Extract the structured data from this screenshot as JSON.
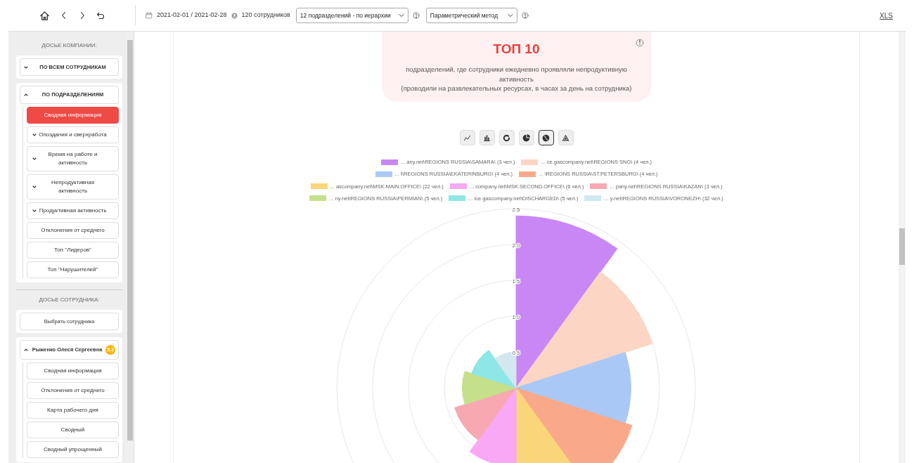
{
  "toolbar": {
    "date_range": "2021-02-01 / 2021-02-28",
    "employees": "120 сотрудников",
    "unit_select": "12 подразделений - по иерархии",
    "method_select": "Параметрический метод",
    "export_link": "XLS"
  },
  "sidebar": {
    "sections": [
      {
        "title": "ДОСЬЕ КОМПАНИИ:",
        "groups": [
          {
            "label": "ПО ВСЕМ СОТРУДНИКАМ",
            "kind": "accordion",
            "expanded": false
          },
          {
            "label": "ПО ПОДРАЗДЕЛЕНИЯМ",
            "kind": "accordion",
            "expanded": true,
            "items": [
              {
                "label": "Сводная информация",
                "kind": "link",
                "selected": true
              },
              {
                "label": "Опоздания и сверхработа",
                "kind": "submenu",
                "selected": false,
                "expanded": false
              },
              {
                "label": "Время на работе и активность",
                "kind": "submenu",
                "selected": false,
                "expanded": false
              },
              {
                "label": "Непродуктивная активность",
                "kind": "submenu",
                "selected": false,
                "expanded": false
              },
              {
                "label": "Продуктивная активность",
                "kind": "submenu",
                "selected": false,
                "expanded": false
              },
              {
                "label": "Отклонения от среднего",
                "kind": "link",
                "selected": false
              },
              {
                "label": "Топ \"Лидеров\"",
                "kind": "link",
                "selected": false
              },
              {
                "label": "Топ \"Нарушителей\"",
                "kind": "link",
                "selected": false
              }
            ]
          }
        ]
      },
      {
        "title": "ДОСЬЕ СОТРУДНИКА:",
        "groups": [
          {
            "label": "Выбрать сотрудника",
            "kind": "button"
          },
          {
            "label": "Рыженко Олеся Сергеевна",
            "kind": "accordion",
            "expanded": true,
            "badge": "5.3",
            "items": [
              {
                "label": "Сводная информация",
                "kind": "link",
                "selected": false
              },
              {
                "label": "Отклонения от среднего",
                "kind": "link",
                "selected": false
              },
              {
                "label": "Карта рабочего дня",
                "kind": "link",
                "selected": false
              },
              {
                "label": "Сводный",
                "kind": "link",
                "selected": false
              },
              {
                "label": "Сводный упрощенный",
                "kind": "link",
                "selected": false
              }
            ]
          }
        ]
      }
    ]
  },
  "report": {
    "title": "ТОП 10",
    "subtitle": "подразделений, где сотрудники ежедневно проявляли непродуктивную активность",
    "note": "(проводили на развлекательных ресурсах, в часах за день на сотрудника)",
    "chart_types": [
      {
        "kind": "line",
        "selected": false
      },
      {
        "kind": "bar",
        "selected": false
      },
      {
        "kind": "doughnut",
        "selected": false
      },
      {
        "kind": "pie",
        "selected": false
      },
      {
        "kind": "polar",
        "selected": true
      },
      {
        "kind": "radar",
        "selected": false
      }
    ],
    "legend": [
      {
        "label": "... any.net\\REGIONS RUSSIA\\SAMARA\\ (3 чел.)",
        "color": "#c987f5"
      },
      {
        "label": "... ce.gascompany.net\\REGIONS SNG\\ (4 чел.)",
        "color": "#fdd5c4"
      },
      {
        "label": "... t\\REGIONS RUSSIA\\EKATERINBURG\\ (4 чел.)",
        "color": "#a9c8f5"
      },
      {
        "label": "... \\REGIONS RUSSIA\\ST.PETERSBURG\\ (4 чел.)",
        "color": "#f9a98a"
      },
      {
        "label": "... ascompany.net\\MSK.MAIN.OFFICE\\ (22 чел.)",
        "color": "#fbd57a"
      },
      {
        "label": "... company.net\\MSK.SECOND.OFFICE\\ (6 чел.)",
        "color": "#f8a8f5"
      },
      {
        "label": "... pany.net\\REGIONS RUSSIA\\KAZAN\\ (3 чел.)",
        "color": "#f7a8b0"
      },
      {
        "label": "... ny.net\\REGIONS RUSSIA\\PERMIAN\\ (5 чел.)",
        "color": "#c5e08a"
      },
      {
        "label": "... ice.gascompany.net\\DISCHARGED\\ (5 чел.)",
        "color": "#8ee6e6"
      },
      {
        "label": "... y.net\\REGIONS RUSSIA\\VORONEZH\\ (32 чел.)",
        "color": "#d2e7ef"
      }
    ],
    "scale_labels": [
      "2.5",
      "2.0",
      "1.5",
      "1.0",
      "0.5"
    ]
  }
}
